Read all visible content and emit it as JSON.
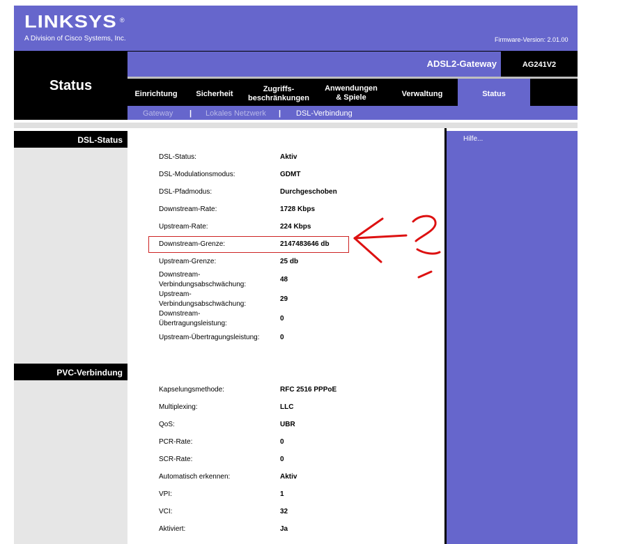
{
  "header": {
    "logo": "LINKSYS",
    "logo_mark": "®",
    "tagline": "A Division of Cisco Systems, Inc.",
    "firmware": "Firmware-Version: 2.01.00"
  },
  "page_title": "Status",
  "product_name": "ADSL2-Gateway",
  "model": "AG241V2",
  "tabs": [
    {
      "label": "Einrichtung"
    },
    {
      "label": "Sicherheit"
    },
    {
      "label_line1": "Zugriffs-",
      "label_line2": "beschränkungen"
    },
    {
      "label_line1": "Anwendungen",
      "label_line2": "& Spiele"
    },
    {
      "label": "Verwaltung"
    },
    {
      "label": "Status",
      "active": true
    }
  ],
  "subnav": {
    "items": [
      "Gateway",
      "Lokales Netzwerk",
      "DSL-Verbindung"
    ],
    "separator": "|",
    "active": "DSL-Verbindung"
  },
  "help_link": "Hilfe...",
  "sections": {
    "dsl_status": {
      "title": "DSL-Status",
      "rows": [
        {
          "label": "DSL-Status:",
          "value": "Aktiv"
        },
        {
          "label": "DSL-Modulationsmodus:",
          "value": "GDMT"
        },
        {
          "label": "DSL-Pfadmodus:",
          "value": "Durchgeschoben"
        },
        {
          "label": "Downstream-Rate:",
          "value": "1728 Kbps"
        },
        {
          "label": "Upstream-Rate:",
          "value": "224 Kbps"
        },
        {
          "label": "Downstream-Grenze:",
          "value": "2147483646 db"
        },
        {
          "label": "Upstream-Grenze:",
          "value": "25 db"
        },
        {
          "label_line1": "Downstream-",
          "label_line2": "Verbindungsabschwächung:",
          "value": "48"
        },
        {
          "label_line1": "Upstream-",
          "label_line2": "Verbindungsabschwächung:",
          "value": "29"
        },
        {
          "label_line1": "Downstream-",
          "label_line2": "Übertragungsleistung:",
          "value": "0"
        },
        {
          "label": "Upstream-Übertragungsleistung:",
          "value": "0"
        }
      ]
    },
    "pvc": {
      "title": "PVC-Verbindung",
      "rows": [
        {
          "label": "Kapselungsmethode:",
          "value": "RFC 2516 PPPoE"
        },
        {
          "label": "Multiplexing:",
          "value": "LLC"
        },
        {
          "label": "QoS:",
          "value": "UBR"
        },
        {
          "label": "PCR-Rate:",
          "value": "0"
        },
        {
          "label": "SCR-Rate:",
          "value": "0"
        },
        {
          "label": "Automatisch erkennen:",
          "value": "Aktiv"
        },
        {
          "label": "VPI:",
          "value": "1"
        },
        {
          "label": "VCI:",
          "value": "32"
        },
        {
          "label": "Aktiviert:",
          "value": "Ja"
        }
      ]
    }
  },
  "colors": {
    "brand_purple": "#6666cc",
    "annotation_red": "#dd1111"
  }
}
